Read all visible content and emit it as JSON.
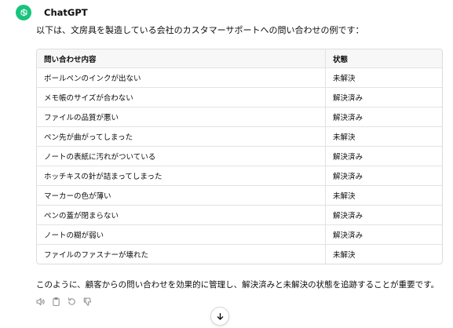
{
  "message": {
    "author": "ChatGPT",
    "intro": "以下は、文房具を製造している会社のカスタマーサポートへの問い合わせの例です：",
    "outro": "このように、顧客からの問い合わせを効果的に管理し、解決済みと未解決の状態を追跡することが重要です。"
  },
  "table": {
    "headers": [
      "問い合わせ内容",
      "状態"
    ],
    "rows": [
      [
        "ボールペンのインクが出ない",
        "未解決"
      ],
      [
        "メモ帳のサイズが合わない",
        "解決済み"
      ],
      [
        "ファイルの品質が悪い",
        "解決済み"
      ],
      [
        "ペン先が曲がってしまった",
        "未解決"
      ],
      [
        "ノートの表紙に汚れがついている",
        "解決済み"
      ],
      [
        "ホッチキスの針が詰まってしまった",
        "解決済み"
      ],
      [
        "マーカーの色が薄い",
        "未解決"
      ],
      [
        "ペンの蓋が閉まらない",
        "解決済み"
      ],
      [
        "ノートの糊が弱い",
        "解決済み"
      ],
      [
        "ファイルのファスナーが壊れた",
        "未解決"
      ]
    ]
  },
  "actions": [
    {
      "name": "read-aloud",
      "icon": "speaker-icon"
    },
    {
      "name": "copy",
      "icon": "copy-icon"
    },
    {
      "name": "regenerate",
      "icon": "refresh-icon"
    },
    {
      "name": "bad-response",
      "icon": "thumbs-down-icon"
    }
  ],
  "colors": {
    "avatar": "#19c37d",
    "text": "#0d0d0d",
    "border": "#dcdcdc",
    "header_bg": "#f7f7f8"
  }
}
